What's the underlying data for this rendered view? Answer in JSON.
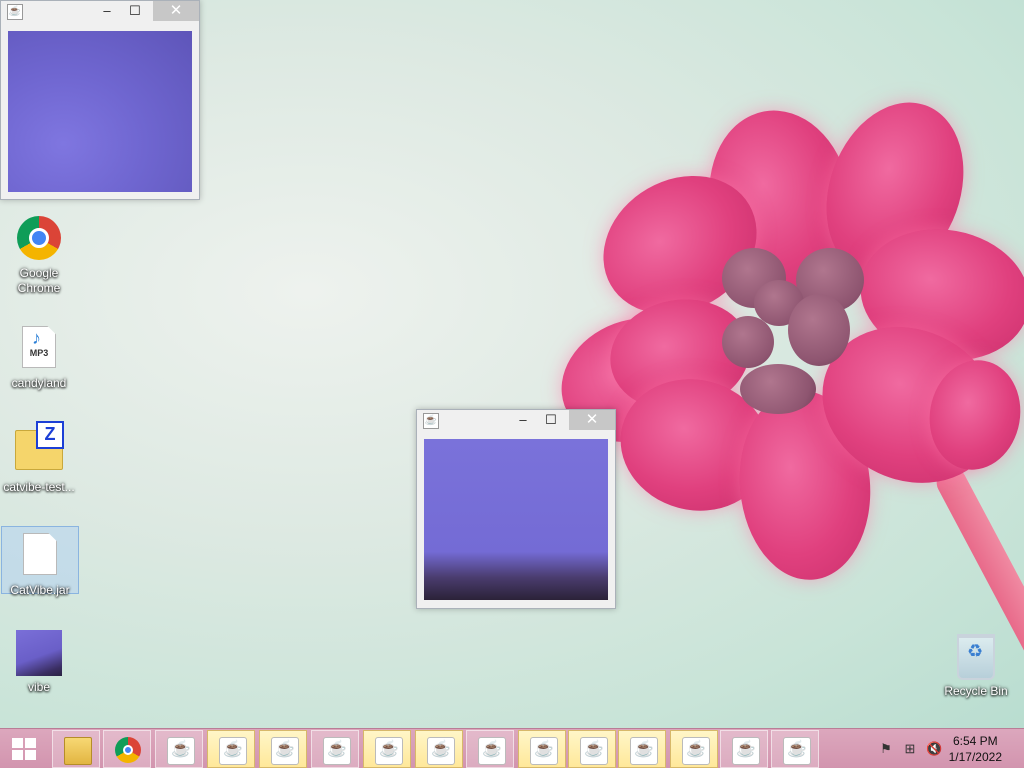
{
  "desktop": {
    "icons": [
      {
        "label": "Google\nChrome",
        "name": "Google Chrome"
      },
      {
        "label": "candyland",
        "badge": "MP3"
      },
      {
        "label": "catvibe-test...",
        "badge": "Z"
      },
      {
        "label": "CatVibe.jar"
      },
      {
        "label": "vibe"
      },
      {
        "label": "Recycle Bin"
      }
    ]
  },
  "windows": [
    {
      "title": "",
      "minimize": "–",
      "maximize": "☐",
      "close": "✕"
    },
    {
      "title": "",
      "minimize": "–",
      "maximize": "☐",
      "close": "✕"
    }
  ],
  "taskbar": {
    "pinned": [
      "File Explorer",
      "Google Chrome"
    ],
    "java_items_count_label": "Java",
    "clock": {
      "time": "6:54 PM",
      "date": "1/17/2022"
    },
    "tray_icons": [
      "action-center-flag-icon",
      "network-icon",
      "volume-muted-icon"
    ]
  },
  "colors": {
    "taskbar": "#d294ae",
    "taskbar_active": "#ffe89a",
    "close_button": "#c7c7c7",
    "video_purple": "#7a72da"
  }
}
